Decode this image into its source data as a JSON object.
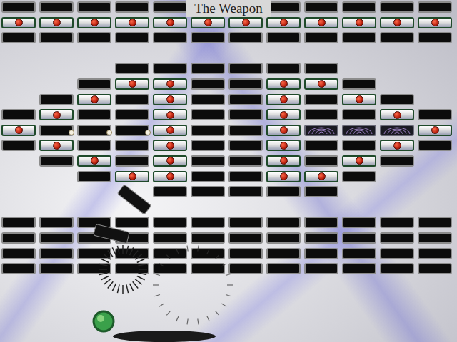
{
  "title": "The Weapon",
  "brick_rows": [
    [
      "plain",
      "plain",
      "plain",
      "plain",
      "plain",
      "plain",
      "plain",
      "plain",
      "plain",
      "plain",
      "plain",
      "plain"
    ],
    [
      "gem",
      "gem",
      "gem",
      "gem",
      "gem",
      "gem",
      "gem",
      "gem",
      "gem",
      "gem",
      "gem",
      "gem"
    ],
    [
      "plain",
      "plain",
      "plain",
      "plain",
      "plain",
      "plain",
      "plain",
      "plain",
      "plain",
      "plain",
      "plain",
      "plain"
    ],
    [
      "none",
      "none",
      "none",
      "none",
      "none",
      "none",
      "none",
      "none",
      "none",
      "none",
      "none",
      "none"
    ],
    [
      "none",
      "none",
      "none",
      "plain",
      "plain",
      "plain",
      "plain",
      "plain",
      "plain",
      "none",
      "none",
      "none"
    ],
    [
      "none",
      "none",
      "plain",
      "gem",
      "gem",
      "plain",
      "plain",
      "gem",
      "gem",
      "plain",
      "none",
      "none"
    ],
    [
      "none",
      "plain",
      "gem",
      "plain",
      "gem",
      "plain",
      "plain",
      "gem",
      "plain",
      "gem",
      "plain",
      "none"
    ],
    [
      "plain",
      "gem",
      "plain",
      "plain",
      "gem",
      "plain",
      "plain",
      "gem",
      "plain",
      "plain",
      "gem",
      "plain"
    ],
    [
      "gem",
      "plain",
      "plain",
      "plain",
      "gem",
      "plain",
      "plain",
      "gem",
      "wave",
      "wave",
      "wave",
      "gem"
    ],
    [
      "plain",
      "gem",
      "plain",
      "plain",
      "gem",
      "plain",
      "plain",
      "gem",
      "plain",
      "plain",
      "gem",
      "plain"
    ],
    [
      "none",
      "plain",
      "gem",
      "plain",
      "gem",
      "plain",
      "plain",
      "gem",
      "plain",
      "gem",
      "plain",
      "none"
    ],
    [
      "none",
      "none",
      "plain",
      "gem",
      "gem",
      "plain",
      "plain",
      "gem",
      "gem",
      "plain",
      "none",
      "none"
    ],
    [
      "none",
      "none",
      "none",
      "none",
      "plain",
      "plain",
      "plain",
      "plain",
      "plain",
      "none",
      "none",
      "none"
    ],
    [
      "none",
      "none",
      "none",
      "none",
      "none",
      "none",
      "none",
      "none",
      "none",
      "none",
      "none",
      "none"
    ],
    [
      "plain",
      "plain",
      "plain",
      "plain",
      "plain",
      "plain",
      "plain",
      "plain",
      "plain",
      "plain",
      "plain",
      "plain"
    ],
    [
      "plain",
      "plain",
      "plain",
      "plain",
      "plain",
      "plain",
      "plain",
      "plain",
      "plain",
      "plain",
      "plain",
      "plain"
    ],
    [
      "plain",
      "plain",
      "plain",
      "plain",
      "plain",
      "plain",
      "plain",
      "plain",
      "plain",
      "plain",
      "plain",
      "plain"
    ],
    [
      "plain",
      "plain",
      "plain",
      "plain",
      "plain",
      "plain",
      "plain",
      "plain",
      "plain",
      "plain",
      "plain",
      "plain"
    ]
  ]
}
